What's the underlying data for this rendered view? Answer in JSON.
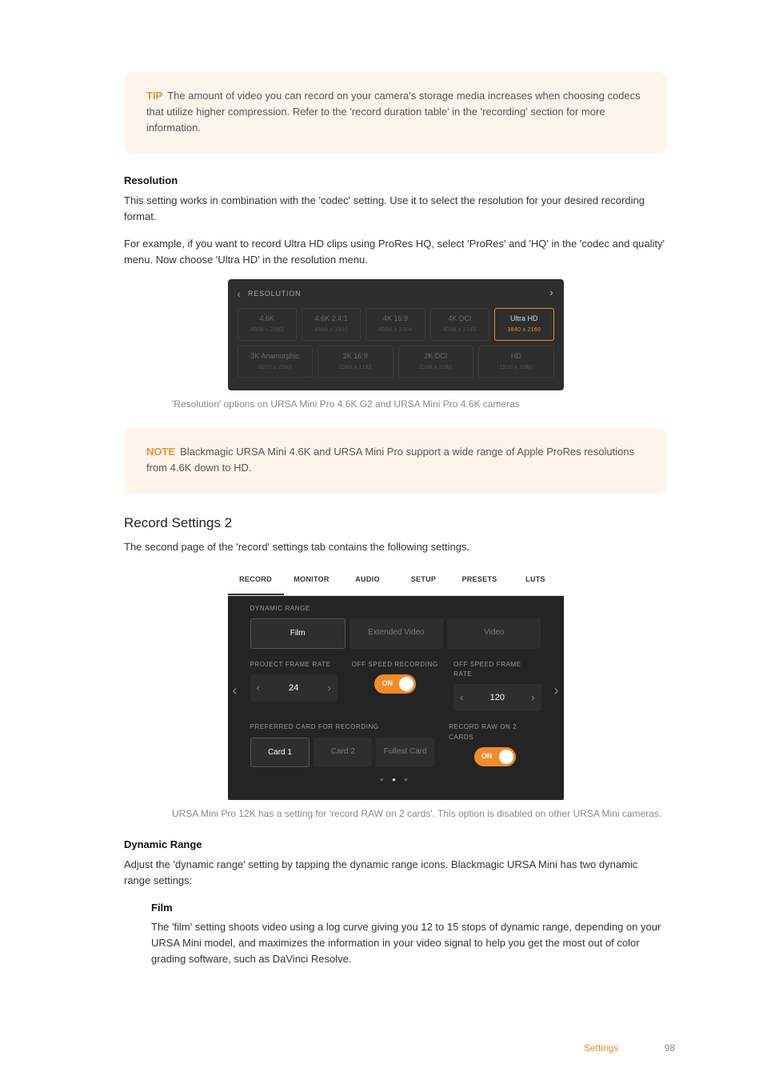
{
  "tip": {
    "tag": "TIP",
    "text": "The amount of video you can record on your camera's storage media increases when choosing codecs that utilize higher compression. Refer to the 'record duration table' in the 'recording' section for more information."
  },
  "resolution": {
    "heading": "Resolution",
    "p1": "This setting works in combination with the 'codec' setting. Use it to select the resolution for your desired recording format.",
    "p2": "For example, if you want to record Ultra HD clips using ProRes HQ, select 'ProRes' and 'HQ' in the 'codec and quality' menu. Now choose 'Ultra HD' in the resolution menu.",
    "caption": "'Resolution' options on URSA Mini Pro 4.6K G2 and URSA Mini Pro 4.6K cameras",
    "title": "RESOLUTION",
    "row1": [
      {
        "t": "4.6K",
        "s": "4608 x 2592"
      },
      {
        "t": "4.6K 2.4:1",
        "s": "4608 x 1920"
      },
      {
        "t": "4K 16:9",
        "s": "4096 x 2304"
      },
      {
        "t": "4K DCI",
        "s": "4096 x 2160"
      },
      {
        "t": "Ultra HD",
        "s": "3840 x 2160"
      }
    ],
    "row2": [
      {
        "t": "3K Anamorphic",
        "s": "3072 x 2560"
      },
      {
        "t": "2K 16:9",
        "s": "2048 x 1152"
      },
      {
        "t": "2K DCI",
        "s": "2048 x 1080"
      },
      {
        "t": "HD",
        "s": "1920 x 1080"
      }
    ]
  },
  "note": {
    "tag": "NOTE",
    "text": "Blackmagic URSA Mini 4.6K and URSA Mini Pro support a wide range of Apple ProRes resolutions from 4.6K down to HD."
  },
  "rec2": {
    "heading": "Record Settings 2",
    "intro": "The second page of the 'record' settings tab contains the following settings.",
    "tabs": [
      "RECORD",
      "MONITOR",
      "AUDIO",
      "SETUP",
      "PRESETS",
      "LUTS"
    ],
    "dyn_label": "DYNAMIC RANGE",
    "dyn_opts": [
      "Film",
      "Extended Video",
      "Video"
    ],
    "pfr_label": "PROJECT FRAME RATE",
    "pfr_value": "24",
    "osr_label": "OFF SPEED RECORDING",
    "on_text": "ON",
    "osfr_label": "OFF SPEED FRAME RATE",
    "osfr_value": "120",
    "pref_label": "PREFERRED CARD FOR RECORDING",
    "pref_opts": [
      "Card 1",
      "Card 2",
      "Fullest Card"
    ],
    "raw2_label": "RECORD RAW ON 2 CARDS",
    "caption": "URSA Mini Pro 12K has a setting for 'record RAW on 2 cards'. This option is disabled on other URSA Mini cameras."
  },
  "dynrange": {
    "heading": "Dynamic Range",
    "text": "Adjust the 'dynamic range' setting by tapping the dynamic range icons. Blackmagic URSA Mini has two dynamic range settings:",
    "film_h": "Film",
    "film_t": "The 'film' setting shoots video using a log curve giving you 12 to 15 stops of dynamic range, depending on your URSA Mini model, and maximizes the information in your video signal to help you get the most out of color grading software, such as DaVinci Resolve."
  },
  "footer": {
    "section": "Settings",
    "page": "98"
  }
}
